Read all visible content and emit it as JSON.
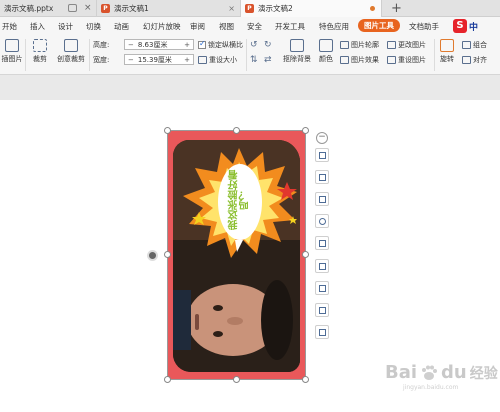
{
  "tabs": [
    {
      "label": "演示文稿.pptx"
    },
    {
      "label": "演示文稿1"
    },
    {
      "label": "演示文稿2"
    }
  ],
  "menu": {
    "items": [
      "开始",
      "插入",
      "设计",
      "切换",
      "动画",
      "幻灯片放映",
      "审阅",
      "视图",
      "安全",
      "开发工具",
      "特色应用",
      "图片工具",
      "文档助手"
    ],
    "active": "图片工具",
    "brand_glyph": "S",
    "brand_text": "中"
  },
  "ribbon": {
    "insert_image": "插图片",
    "crop": "裁剪",
    "creative_crop": "创意裁剪",
    "height_label": "高度:",
    "height_value": "8.63厘米",
    "width_label": "宽度:",
    "width_value": "15.39厘米",
    "lock_ratio": "锁定纵横比",
    "reset_size": "重设大小",
    "remove_bg": "抠除背景",
    "color": "颜色",
    "picture_outline": "图片轮廓",
    "picture_effect": "图片效果",
    "change_picture": "更改图片",
    "reset_picture": "重设图片",
    "rotate": "旋转",
    "group": "组合",
    "align": "对齐"
  },
  "picture": {
    "bubble_text": "我这张脸好看吗？"
  },
  "watermark": {
    "logo_text": "Bai",
    "logo_text2": "du",
    "zh": "经验",
    "url": "jingyan.baidu.com"
  }
}
